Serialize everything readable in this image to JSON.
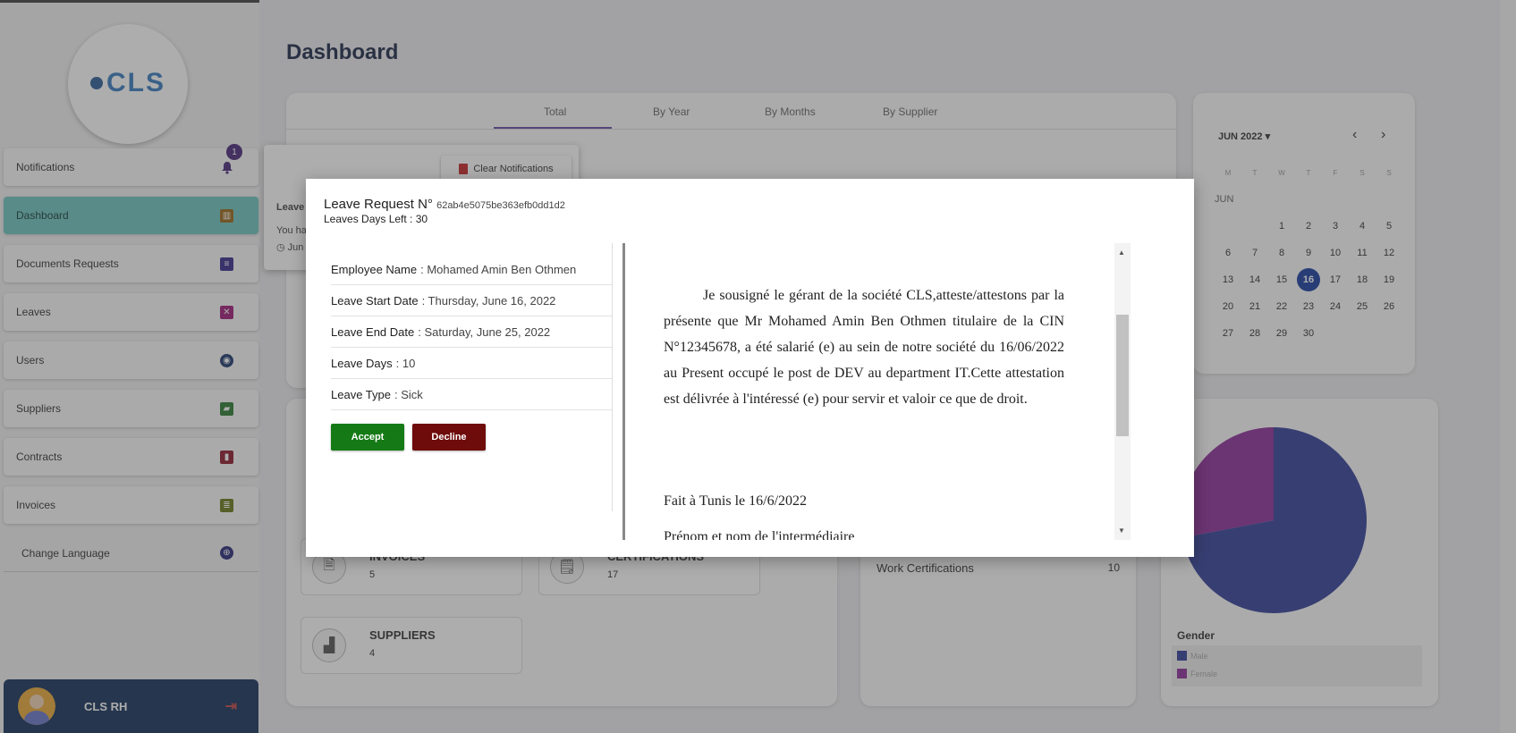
{
  "app": {
    "title": "Dashboard",
    "logo": "CLS"
  },
  "sidebar": {
    "items": [
      {
        "label": "Notifications",
        "icon": "bell-icon",
        "badge": "1"
      },
      {
        "label": "Dashboard",
        "icon": "chart-icon"
      },
      {
        "label": "Documents Requests",
        "icon": "document-icon"
      },
      {
        "label": "Leaves",
        "icon": "briefcase-icon"
      },
      {
        "label": "Users",
        "icon": "users-icon"
      },
      {
        "label": "Suppliers",
        "icon": "truck-icon"
      },
      {
        "label": "Contracts",
        "icon": "bookmark-icon"
      },
      {
        "label": "Invoices",
        "icon": "invoice-icon"
      },
      {
        "label": "Change Language",
        "icon": "globe-icon"
      }
    ],
    "user": {
      "name": "CLS RH"
    }
  },
  "tabs": [
    "Total",
    "By Year",
    "By Months",
    "By Supplier"
  ],
  "notifications": {
    "clear_label": "Clear Notifications",
    "line1": "Leave",
    "line2": "You ha",
    "line3": "Jun"
  },
  "calendar": {
    "month_label": "JUN 2022",
    "month_short": "JUN",
    "dow": [
      "M",
      "T",
      "W",
      "T",
      "F",
      "S",
      "S"
    ],
    "weeks": [
      [
        "",
        "",
        "1",
        "2",
        "3",
        "4",
        "5"
      ],
      [
        "6",
        "7",
        "8",
        "9",
        "10",
        "11",
        "12"
      ],
      [
        "13",
        "14",
        "15",
        "16",
        "17",
        "18",
        "19"
      ],
      [
        "20",
        "21",
        "22",
        "23",
        "24",
        "25",
        "26"
      ],
      [
        "27",
        "28",
        "29",
        "30",
        "",
        "",
        ""
      ]
    ],
    "today": "16"
  },
  "stats": {
    "invoices": {
      "label": "INVOICES",
      "value": "5"
    },
    "certifications": {
      "label": "CERTIFICATIONS",
      "value": "17"
    },
    "suppliers": {
      "label": "SUPPLIERS",
      "value": "4"
    }
  },
  "requests": {
    "label": "Work Certifications",
    "value": "10"
  },
  "gender": {
    "title": "Gender",
    "legend": [
      {
        "label": "Male",
        "color": "#35409a"
      },
      {
        "label": "Female",
        "color": "#8e2f9a"
      }
    ]
  },
  "chart_data": {
    "type": "pie",
    "title": "Gender",
    "categories": [
      "Male",
      "Female"
    ],
    "values": [
      72,
      28
    ],
    "colors": [
      "#35409a",
      "#8e2f9a"
    ]
  },
  "modal": {
    "title": "Leave Request N°",
    "request_id": "62ab4e5075be363efb0dd1d2",
    "days_left": "Leaves Days Left : 30",
    "fields": [
      {
        "label": "Employee Name",
        "value": ": Mohamed Amin Ben Othmen"
      },
      {
        "label": "Leave Start Date",
        "value": ": Thursday, June 16, 2022"
      },
      {
        "label": "Leave End Date",
        "value": ": Saturday, June 25, 2022"
      },
      {
        "label": "Leave Days",
        "value": ": 10"
      },
      {
        "label": "Leave Type",
        "value": ": Sick"
      }
    ],
    "accept_label": "Accept",
    "decline_label": "Decline",
    "document": {
      "paragraph": "Je sousigné le gérant de la société CLS,atteste/attestons par la présente que Mr Mohamed Amin Ben Othmen titulaire de la CIN N°12345678, a été salarié (e) au sein de notre société du 16/06/2022 au Present occupé le post de DEV au department IT.Cette attestation est délivrée à l'intéressé (e) pour servir et valoir ce que de droit.",
      "signature_place": "Fait à Tunis le 16/6/2022",
      "signature_name": "Prénom et nom de l'intermédiaire"
    }
  }
}
